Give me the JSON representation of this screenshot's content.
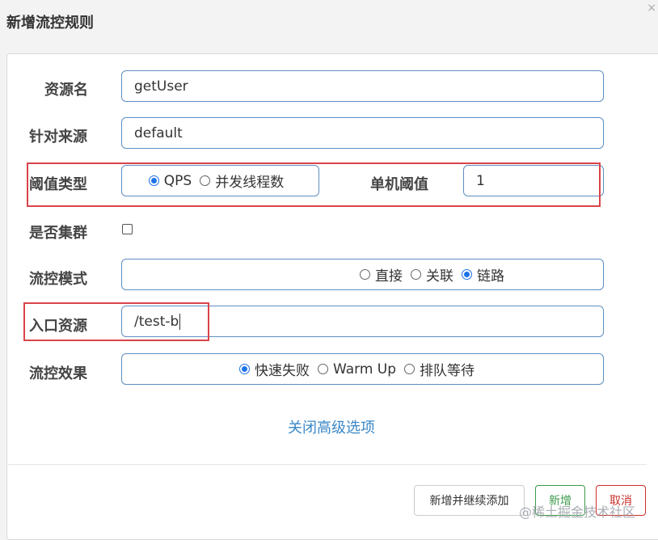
{
  "dialog": {
    "title": "新增流控规则"
  },
  "form": {
    "resource": {
      "label": "资源名",
      "value": "getUser"
    },
    "limit_app": {
      "label": "针对来源",
      "value": "default"
    },
    "grade": {
      "label": "阈值类型",
      "options": [
        "QPS",
        "并发线程数"
      ],
      "selected": "QPS"
    },
    "threshold": {
      "label": "单机阈值",
      "value": "1"
    },
    "cluster": {
      "label": "是否集群",
      "checked": false
    },
    "strategy": {
      "label": "流控模式",
      "options": [
        "直接",
        "关联",
        "链路"
      ],
      "selected": "链路"
    },
    "ref_resource": {
      "label": "入口资源",
      "value": "/test-b"
    },
    "control_behavior": {
      "label": "流控效果",
      "options": [
        "快速失败",
        "Warm Up",
        "排队等待"
      ],
      "selected": "快速失败"
    }
  },
  "advanced_link": "关闭高级选项",
  "buttons": {
    "add_continue": "新增并继续添加",
    "add": "新增",
    "cancel": "取消"
  },
  "watermark": "@稀土掘金技术社区",
  "colors": {
    "highlight_box": "#d9444a",
    "input_border": "#5e8fc0",
    "link": "#3a87c8",
    "radio_selected": "#1e73e8"
  }
}
